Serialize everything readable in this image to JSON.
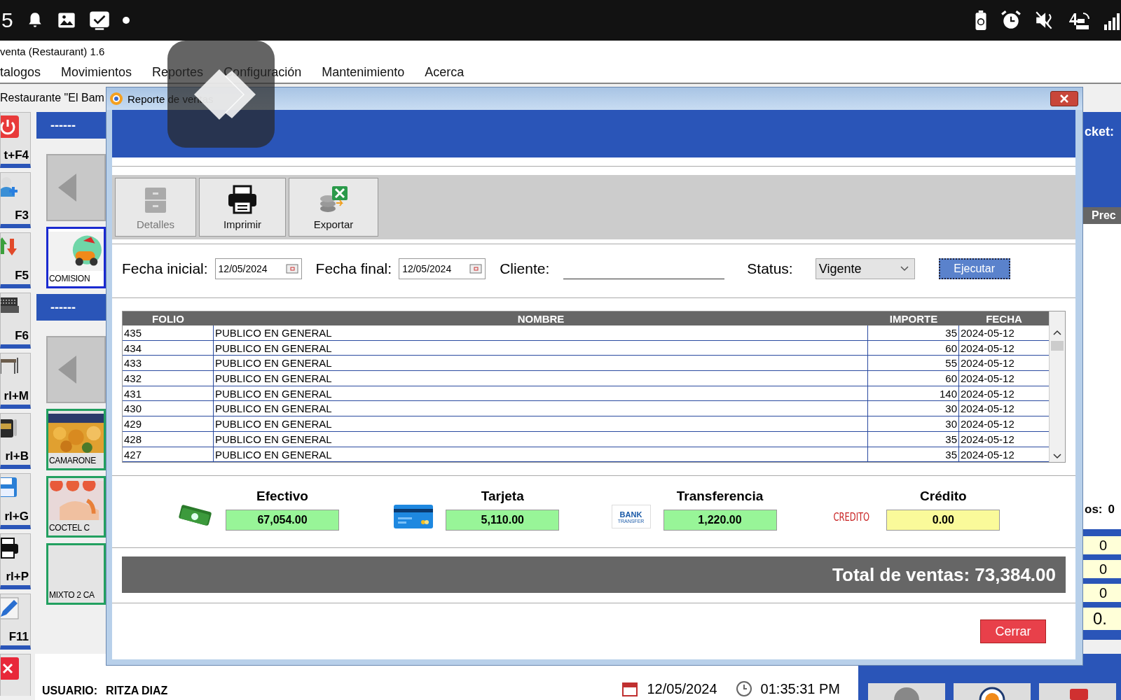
{
  "status_bar": {
    "time": "5"
  },
  "app": {
    "title": "venta (Restaurant) 1.6",
    "menu": [
      "talogos",
      "Movimientos",
      "Reportes",
      "Configuración",
      "Mantenimiento",
      "Acerca"
    ],
    "tab_title": "Restaurante \"El Bam",
    "shortcuts": [
      "t+F4",
      "F3",
      "F5",
      "F6",
      "rl+M",
      "rl+B",
      "rl+G",
      "rl+P",
      "F11"
    ],
    "section_heading": "------",
    "products": [
      {
        "label": "COMISION",
        "kind": "picture",
        "selected": true
      },
      {
        "label": "CAMARONE",
        "kind": "picture",
        "selected": false
      },
      {
        "label": "COCTEL C",
        "kind": "picture",
        "selected": false
      },
      {
        "label": "MIXTO 2 CA",
        "kind": "plain",
        "selected": false
      }
    ],
    "ticket_label": "cket:",
    "price_header": "Prec",
    "items_label": "os:",
    "items_value": "0",
    "totals": [
      "0",
      "0",
      "0",
      "0."
    ],
    "user_label": "USUARIO:",
    "user_name": "RITZA DIAZ",
    "date": "12/05/2024",
    "clock": "01:35:31 PM"
  },
  "dialog": {
    "title": "Reporte de ventas",
    "toolbar": [
      {
        "label": "Detalles",
        "disabled": true
      },
      {
        "label": "Imprimir",
        "disabled": false
      },
      {
        "label": "Exportar",
        "disabled": false
      }
    ],
    "filters": {
      "start_label": "Fecha inicial:",
      "start_value": "12/05/2024",
      "end_label": "Fecha final:",
      "end_value": "12/05/2024",
      "client_label": "Cliente:",
      "status_label": "Status:",
      "status_value": "Vigente",
      "run_button": "Ejecutar"
    },
    "table": {
      "columns": [
        "FOLIO",
        "NOMBRE",
        "IMPORTE",
        "FECHA"
      ],
      "rows": [
        [
          "435",
          "PUBLICO EN GENERAL",
          "35",
          "2024-05-12"
        ],
        [
          "434",
          "PUBLICO EN GENERAL",
          "60",
          "2024-05-12"
        ],
        [
          "433",
          "PUBLICO EN GENERAL",
          "55",
          "2024-05-12"
        ],
        [
          "432",
          "PUBLICO EN GENERAL",
          "60",
          "2024-05-12"
        ],
        [
          "431",
          "PUBLICO EN GENERAL",
          "140",
          "2024-05-12"
        ],
        [
          "430",
          "PUBLICO EN GENERAL",
          "30",
          "2024-05-12"
        ],
        [
          "429",
          "PUBLICO EN GENERAL",
          "30",
          "2024-05-12"
        ],
        [
          "428",
          "PUBLICO EN GENERAL",
          "35",
          "2024-05-12"
        ],
        [
          "427",
          "PUBLICO EN GENERAL",
          "35",
          "2024-05-12"
        ]
      ]
    },
    "payments": [
      {
        "kind": "cash",
        "label": "Efectivo",
        "value": "67,054.00",
        "color": "#98f598"
      },
      {
        "kind": "card",
        "label": "Tarjeta",
        "value": "5,110.00",
        "color": "#98f598"
      },
      {
        "kind": "transfer",
        "label": "Transferencia",
        "value": "1,220.00",
        "color": "#98f598",
        "icon_text": "BANK",
        "icon_subtext": "TRANSFER"
      },
      {
        "kind": "credit",
        "label": "Crédito",
        "value": "0.00",
        "color": "#fafa9a",
        "icon_text": "CREDITO"
      }
    ],
    "total": "Total de ventas: 73,384.00",
    "close_button": "Cerrar"
  }
}
